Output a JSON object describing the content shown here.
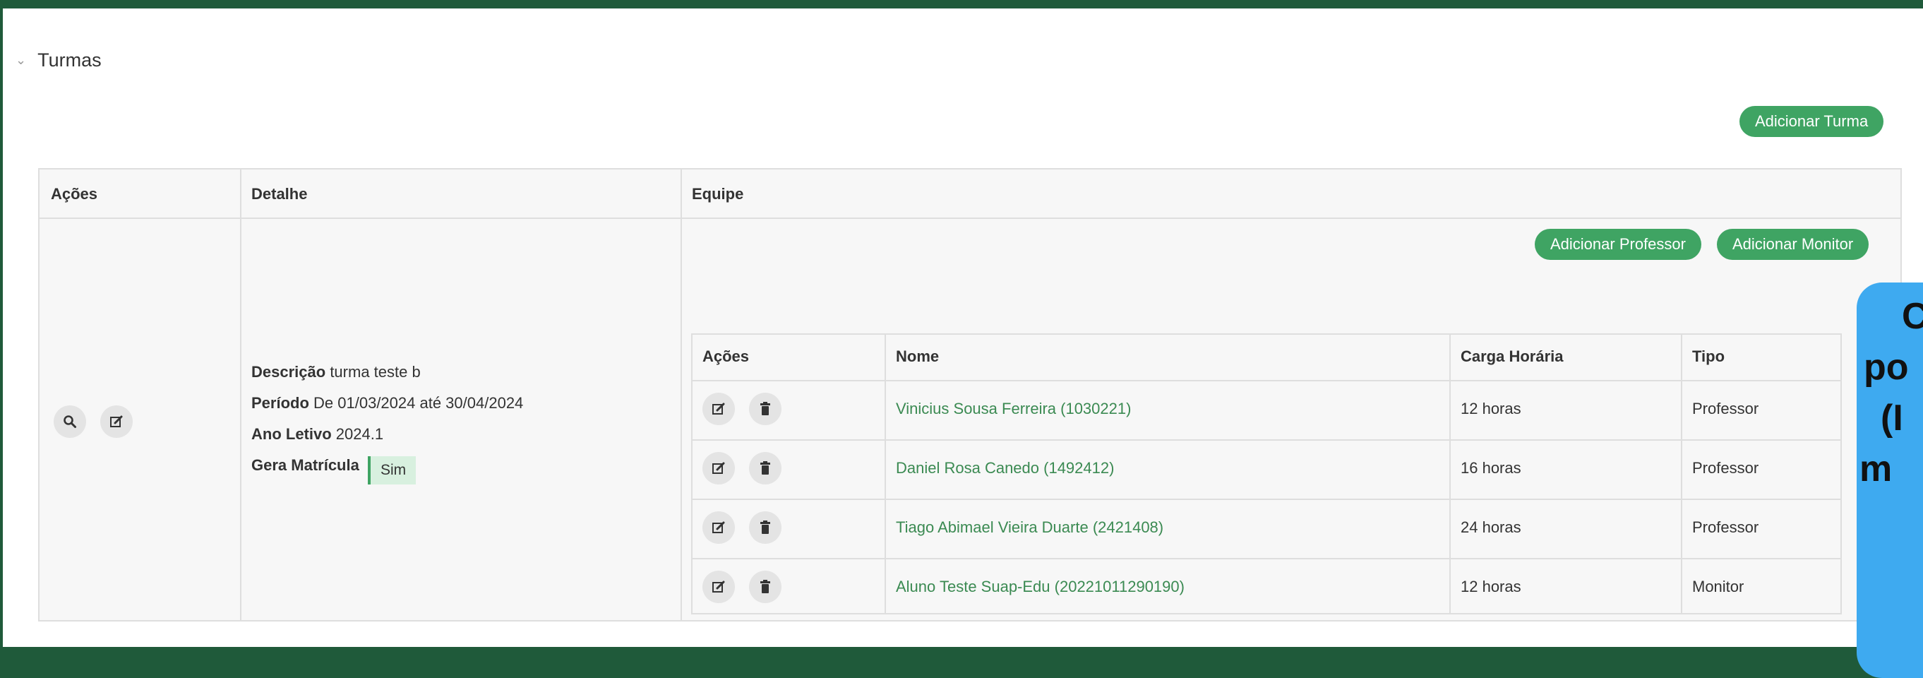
{
  "section": {
    "title": "Turmas"
  },
  "buttons": {
    "add_turma": "Adicionar Turma",
    "add_professor": "Adicionar Professor",
    "add_monitor": "Adicionar Monitor"
  },
  "table": {
    "headers": {
      "acoes": "Ações",
      "detalhe": "Detalhe",
      "equipe": "Equipe"
    },
    "detalhe": {
      "descricao_label": "Descrição",
      "descricao_value": "turma teste b",
      "periodo_label": "Período",
      "periodo_value": "De 01/03/2024 até 30/04/2024",
      "ano_label": "Ano Letivo",
      "ano_value": "2024.1",
      "gera_label": "Gera Matrícula",
      "gera_value": "Sim"
    }
  },
  "equipe": {
    "headers": {
      "acoes": "Ações",
      "nome": "Nome",
      "carga": "Carga Horária",
      "tipo": "Tipo"
    },
    "rows": [
      {
        "nome": "Vinicius Sousa Ferreira (1030221)",
        "carga": "12 horas",
        "tipo": "Professor"
      },
      {
        "nome": "Daniel Rosa Canedo (1492412)",
        "carga": "16 horas",
        "tipo": "Professor"
      },
      {
        "nome": "Tiago Abimael Vieira Duarte (2421408)",
        "carga": "24 horas",
        "tipo": "Professor"
      },
      {
        "nome": "Aluno Teste Suap-Edu (20221011290190)",
        "carga": "12 horas",
        "tipo": "Monitor"
      }
    ]
  },
  "overlay": {
    "lines": [
      "C",
      "po",
      "(I",
      "m"
    ]
  },
  "colors": {
    "accent": "#3fa463",
    "link": "#3b8a52",
    "overlay": "#3eaaf0"
  },
  "icons": [
    "chevron-down-icon",
    "search-icon",
    "edit-icon",
    "trash-icon"
  ]
}
